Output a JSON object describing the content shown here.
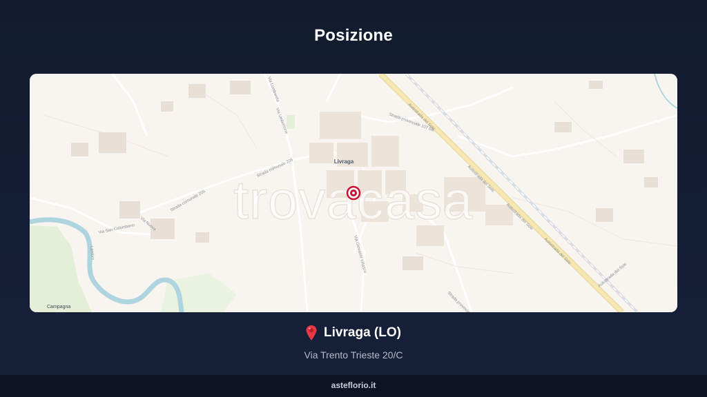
{
  "page": {
    "title": "Posizione"
  },
  "map": {
    "watermark": "trovacasa",
    "town_label": "Livraga",
    "corner_label": "Campagna",
    "road_labels": {
      "autostrada_1": "Autostrada del Sole",
      "autostrada_2": "Autostrada del Sole",
      "autostrada_3": "Autostrada del Sole",
      "autostrada_4": "Autostrada del Sole",
      "autostrada_5": "Autostrada del Sole",
      "sp107": "Strada provinciale 107 bis",
      "sp_south": "Strada provinciale",
      "sp206_a": "Strada comunale 206",
      "sp206_b": "Strada comunale 206",
      "via_umbertone": "Via Umbertone",
      "via_san_colombano": "Via San Colombano",
      "via_giovanni_villasco": "Via Giovanni Villasco",
      "via_nuova": "Via Nuova",
      "lambro": "Lambro",
      "nord": "Via Lombardia"
    },
    "colors": {
      "background": "#f8f4f0",
      "highway": "#f3e3a6",
      "water": "#aed5df",
      "marker": "#c8102e"
    }
  },
  "location": {
    "pin_icon": "map-pin-icon",
    "name": "Livraga (LO)",
    "address": "Via Trento Trieste 20/C"
  },
  "footer": {
    "site": "asteflorio.it"
  }
}
